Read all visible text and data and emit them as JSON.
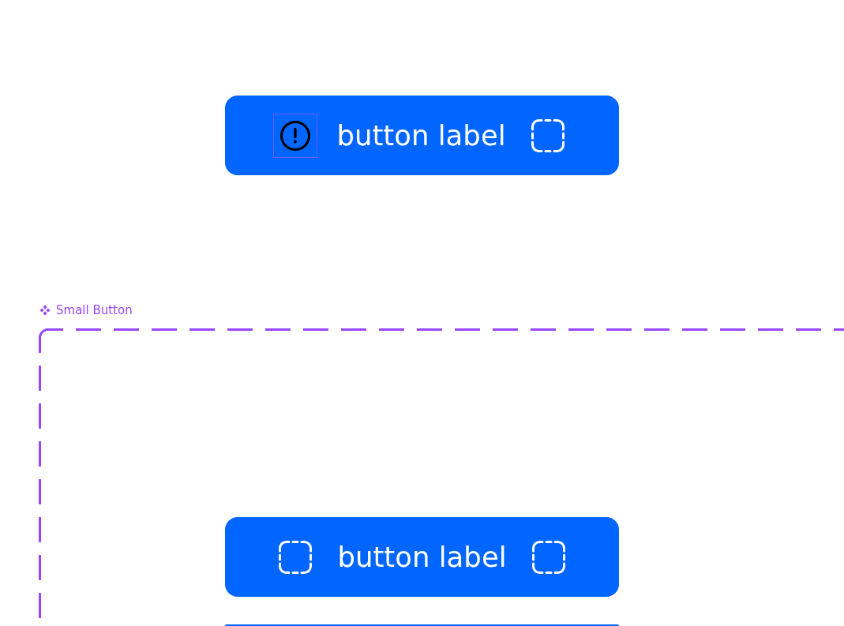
{
  "canvas": {
    "buttons": [
      {
        "label": "button label",
        "icons": [
          {
            "kind": "alert",
            "selected": true
          },
          {
            "kind": "slot",
            "selected": false
          }
        ]
      }
    ],
    "frame": {
      "title": "Small Button",
      "buttons": [
        {
          "label": "button label",
          "icons": [
            {
              "kind": "slot",
              "selected": false
            },
            {
              "kind": "slot",
              "selected": false
            }
          ]
        }
      ]
    }
  }
}
